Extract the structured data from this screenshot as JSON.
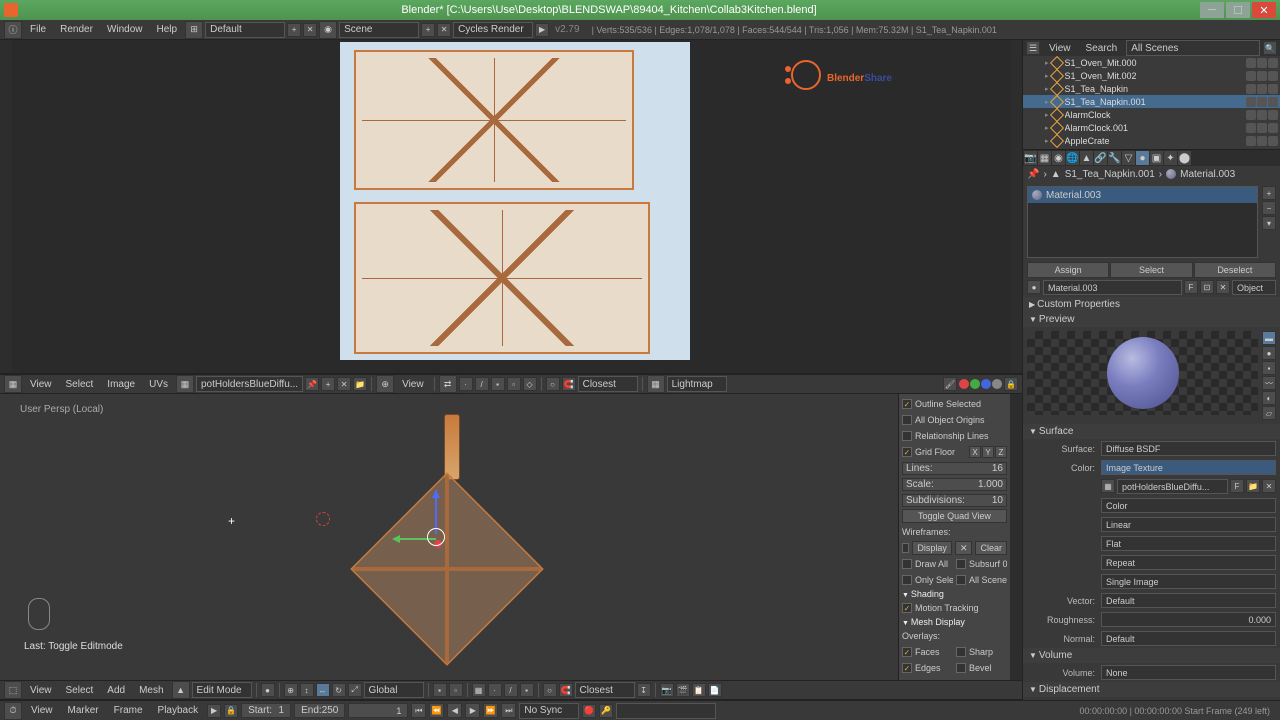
{
  "title": "Blender* [C:\\Users\\Use\\Desktop\\BLENDSWAP\\89404_Kitchen\\Collab3Kitchen.blend]",
  "menubar": {
    "file": "File",
    "render": "Render",
    "window": "Window",
    "help": "Help",
    "layout": "Default",
    "scene": "Scene",
    "engine": "Cycles Render"
  },
  "version": "v2.79",
  "stats": "| Verts:535/536 | Edges:1,078/1,078 | Faces:544/544 | Tris:1,056 | Mem:75.32M | S1_Tea_Napkin.001",
  "watermark": {
    "b": "Blender",
    "s": "Share"
  },
  "uv_header": {
    "view": "View",
    "select": "Select",
    "image": "Image",
    "uvs": "UVs",
    "img_name": "potHoldersBlueDiffu...",
    "view2": "View",
    "snap": "Closest",
    "uvmap": "Lightmap"
  },
  "v3d": {
    "label": "User Persp (Local)",
    "last": "Last: Toggle Editmode"
  },
  "v3d_header": {
    "view": "View",
    "select": "Select",
    "add": "Add",
    "mesh": "Mesh",
    "mode": "Edit Mode",
    "orient": "Global",
    "snap": "Closest"
  },
  "npanel": {
    "outline": "Outline Selected",
    "origins": "All Object Origins",
    "rel": "Relationship Lines",
    "grid": "Grid Floor",
    "lines_l": "Lines:",
    "lines_v": "16",
    "scale_l": "Scale:",
    "scale_v": "1.000",
    "subdiv_l": "Subdivisions:",
    "subdiv_v": "10",
    "quad": "Toggle Quad View",
    "wireframes": "Wireframes:",
    "display": "Display",
    "clear": "Clear",
    "drawall": "Draw All",
    "subsurf": "Subsurf 0",
    "onlysel": "Only Sele",
    "allscene": "All Scene",
    "shading": "Shading",
    "motion": "Motion Tracking",
    "meshdisp": "Mesh Display",
    "overlays": "Overlays:",
    "faces": "Faces",
    "sharp": "Sharp",
    "edges": "Edges",
    "bevel": "Bevel"
  },
  "outliner": {
    "view": "View",
    "search": "Search",
    "scenes": "All Scenes",
    "items": [
      {
        "n": "S1_Oven_Mit.000"
      },
      {
        "n": "S1_Oven_Mit.002"
      },
      {
        "n": "S1_Tea_Napkin"
      },
      {
        "n": "S1_Tea_Napkin.001",
        "sel": true
      },
      {
        "n": "AlarmClock"
      },
      {
        "n": "AlarmClock.001"
      },
      {
        "n": "AppleCrate"
      }
    ]
  },
  "breadcrumb": {
    "obj": "S1_Tea_Napkin.001",
    "mat": "Material.003"
  },
  "material": {
    "slot": "Material.003",
    "assign": "Assign",
    "select": "Select",
    "deselect": "Deselect",
    "name": "Material.003",
    "type": "Object"
  },
  "panels": {
    "custom": "Custom Properties",
    "preview": "Preview",
    "surface": "Surface",
    "volume": "Volume",
    "displacement": "Displacement"
  },
  "surface": {
    "surf_l": "Surface:",
    "surf_v": "Diffuse BSDF",
    "color_l": "Color:",
    "color_v": "Image Texture",
    "img": "potHoldersBlueDiffu...",
    "cs": "Color",
    "interp": "Linear",
    "proj": "Flat",
    "ext": "Repeat",
    "src": "Single Image",
    "vec_l": "Vector:",
    "vec_v": "Default",
    "rough_l": "Roughness:",
    "rough_v": "0.000",
    "norm_l": "Normal:",
    "norm_v": "Default"
  },
  "volume": {
    "l": "Volume:",
    "v": "None"
  },
  "timeline": {
    "view": "View",
    "marker": "Marker",
    "frame": "Frame",
    "playback": "Playback",
    "start_l": "Start:",
    "start_v": "1",
    "end_l": "End:",
    "end_v": "250",
    "cur": "1",
    "sync": "No Sync",
    "status": "00:00:00:00 | 00:00:00:00       Start Frame (249 left)"
  }
}
